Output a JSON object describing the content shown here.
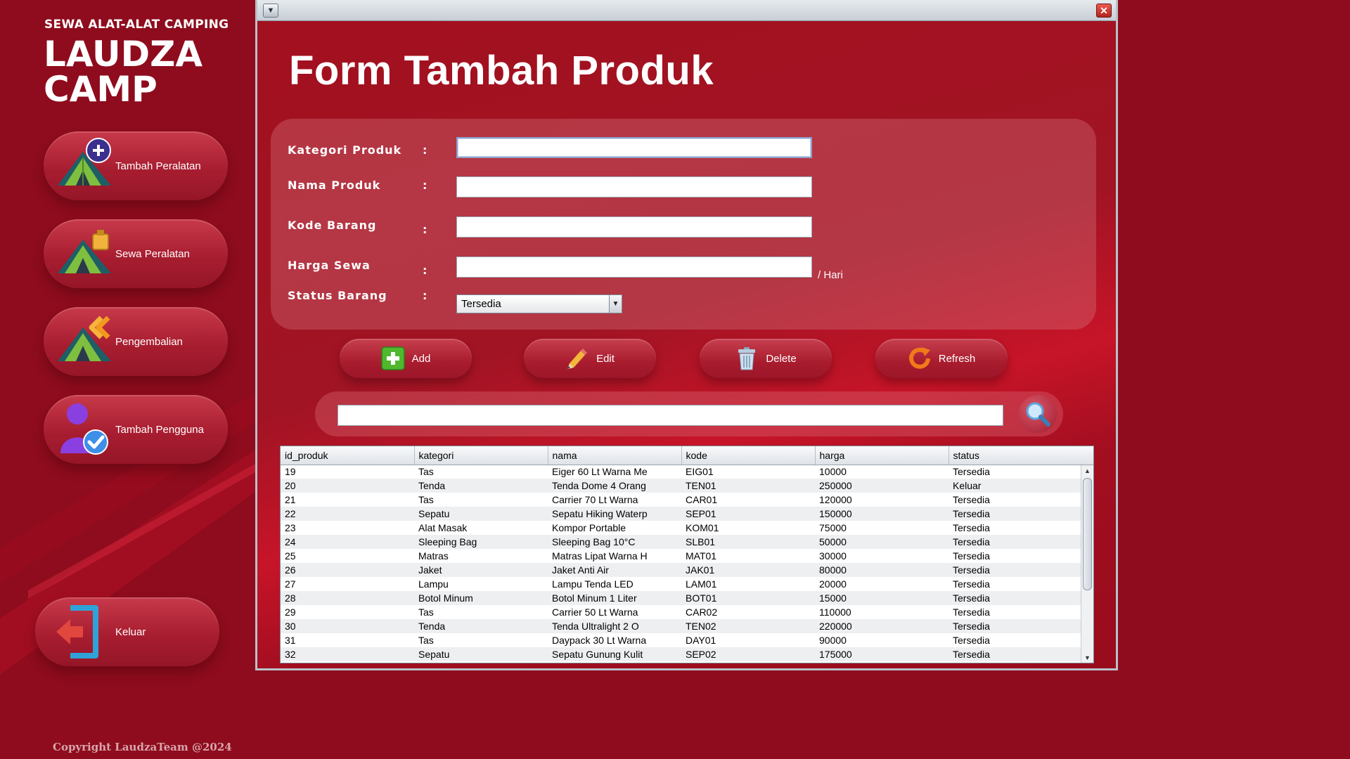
{
  "brand": {
    "subtitle": "SEWA ALAT-ALAT CAMPING",
    "title": "LAUDZA CAMP"
  },
  "sidebar": {
    "items": [
      {
        "label": "Tambah Peralatan",
        "icon": "tent-add-icon"
      },
      {
        "label": "Sewa Peralatan",
        "icon": "tent-rent-icon"
      },
      {
        "label": "Pengembalian",
        "icon": "tent-return-icon"
      },
      {
        "label": "Tambah Pengguna",
        "icon": "user-add-icon"
      }
    ],
    "logout_label": "Keluar"
  },
  "copyright": "Copyright LaudzaTeam @2024",
  "window": {
    "menu_icon": "chevron-down-icon",
    "close_icon": "close-icon"
  },
  "form": {
    "title": "Form Tambah Produk",
    "fields": [
      {
        "label": "Kategori Produk",
        "value": ""
      },
      {
        "label": "Nama Produk",
        "value": ""
      },
      {
        "label": "Kode Barang",
        "value": ""
      },
      {
        "label": "Harga Sewa",
        "value": ""
      }
    ],
    "colon": ":",
    "price_suffix": "/ Hari",
    "status_label": "Status Barang",
    "status_value": "Tersedia"
  },
  "actions": {
    "add": "Add",
    "edit": "Edit",
    "delete": "Delete",
    "refresh": "Refresh"
  },
  "search": {
    "value": "",
    "icon": "search-icon"
  },
  "table": {
    "columns": [
      "id_produk",
      "kategori",
      "nama",
      "kode",
      "harga",
      "status"
    ],
    "rows": [
      [
        "19",
        "Tas",
        "Eiger 60 Lt Warna Me",
        "EIG01",
        "10000",
        "Tersedia"
      ],
      [
        "20",
        "Tenda",
        "Tenda Dome 4 Orang",
        "TEN01",
        "250000",
        "Keluar"
      ],
      [
        "21",
        "Tas",
        "Carrier 70 Lt Warna",
        "CAR01",
        "120000",
        "Tersedia"
      ],
      [
        "22",
        "Sepatu",
        "Sepatu Hiking Waterp",
        "SEP01",
        "150000",
        "Tersedia"
      ],
      [
        "23",
        "Alat Masak",
        "Kompor Portable",
        "KOM01",
        "75000",
        "Tersedia"
      ],
      [
        "24",
        "Sleeping Bag",
        "Sleeping Bag 10°C",
        "SLB01",
        "50000",
        "Tersedia"
      ],
      [
        "25",
        "Matras",
        "Matras Lipat Warna H",
        "MAT01",
        "30000",
        "Tersedia"
      ],
      [
        "26",
        "Jaket",
        "Jaket Anti Air",
        "JAK01",
        "80000",
        "Tersedia"
      ],
      [
        "27",
        "Lampu",
        "Lampu Tenda LED",
        "LAM01",
        "20000",
        "Tersedia"
      ],
      [
        "28",
        "Botol Minum",
        "Botol Minum 1 Liter",
        "BOT01",
        "15000",
        "Tersedia"
      ],
      [
        "29",
        "Tas",
        "Carrier 50 Lt Warna",
        "CAR02",
        "110000",
        "Tersedia"
      ],
      [
        "30",
        "Tenda",
        "Tenda Ultralight 2 O",
        "TEN02",
        "220000",
        "Tersedia"
      ],
      [
        "31",
        "Tas",
        "Daypack 30 Lt Warna",
        "DAY01",
        "90000",
        "Tersedia"
      ],
      [
        "32",
        "Sepatu",
        "Sepatu Gunung Kulit",
        "SEP02",
        "175000",
        "Tersedia"
      ]
    ]
  },
  "colors": {
    "background": "#8e0c1d",
    "panel": "#a3101f",
    "accent": "#c71428"
  }
}
